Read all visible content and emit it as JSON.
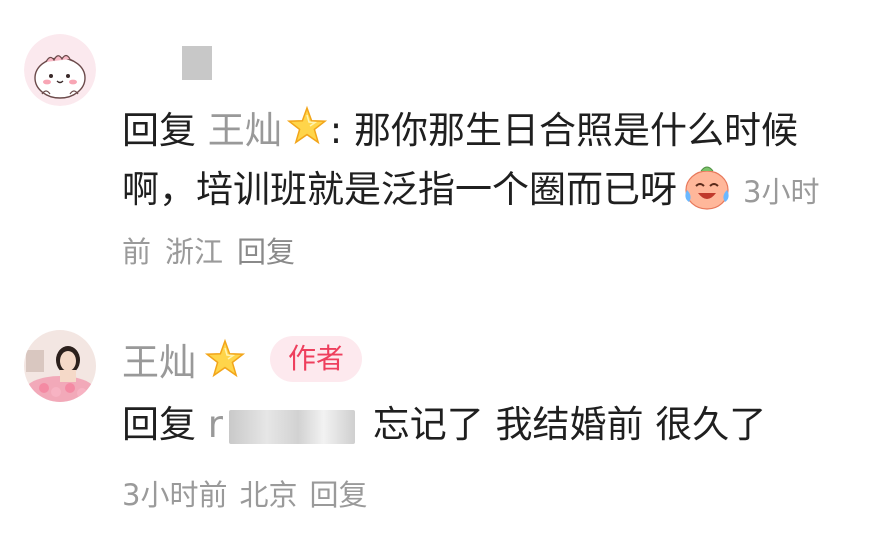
{
  "comments": [
    {
      "author_name": "",
      "reply_prefix": "回复",
      "reply_target": "王灿",
      "text": ": 那你那生日合照是什么时候啊，培训班就是泛指一个圈而已呀",
      "meta": {
        "time": "3小时前",
        "location": "浙江",
        "reply_label": "回复"
      }
    },
    {
      "author_name": "王灿",
      "author_tag": "作者",
      "reply_prefix": "回复",
      "reply_target_visible": "r",
      "text": "忘记了 我结婚前 很久了",
      "meta": {
        "time": "3小时前",
        "location": "北京",
        "reply_label": "回复"
      }
    }
  ],
  "colors": {
    "muted": "#999999",
    "author_tag_text": "#ee3f5d",
    "author_tag_bg": "#fde9ee"
  },
  "icons": {
    "badge": "gold-star-icon",
    "emoji": "laughing-crying-emoji-icon"
  }
}
